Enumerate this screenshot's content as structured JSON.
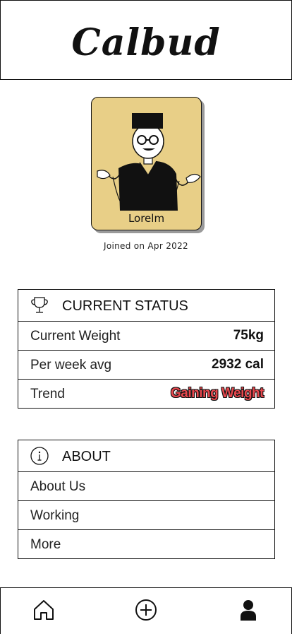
{
  "app": {
    "title": "Calbud"
  },
  "profile": {
    "name": "Lorelm",
    "joined": "Joined on Apr 2022"
  },
  "status": {
    "title": "CURRENT STATUS",
    "icon": "trophy-icon",
    "rows": [
      {
        "label": "Current Weight",
        "value": "75kg"
      },
      {
        "label": "Per week avg",
        "value": "2932 cal"
      },
      {
        "label": "Trend",
        "value": "Gaining Weight"
      }
    ],
    "trend_color": "#e8474d"
  },
  "about": {
    "title": "ABOUT",
    "icon": "info-icon",
    "items": [
      {
        "label": "About Us"
      },
      {
        "label": "Working"
      },
      {
        "label": "More"
      }
    ]
  },
  "nav": {
    "items": [
      {
        "icon": "home-icon"
      },
      {
        "icon": "add-circle-icon"
      },
      {
        "icon": "user-icon"
      }
    ]
  },
  "colors": {
    "avatar_bg": "#e8cf87",
    "border": "#111111"
  }
}
